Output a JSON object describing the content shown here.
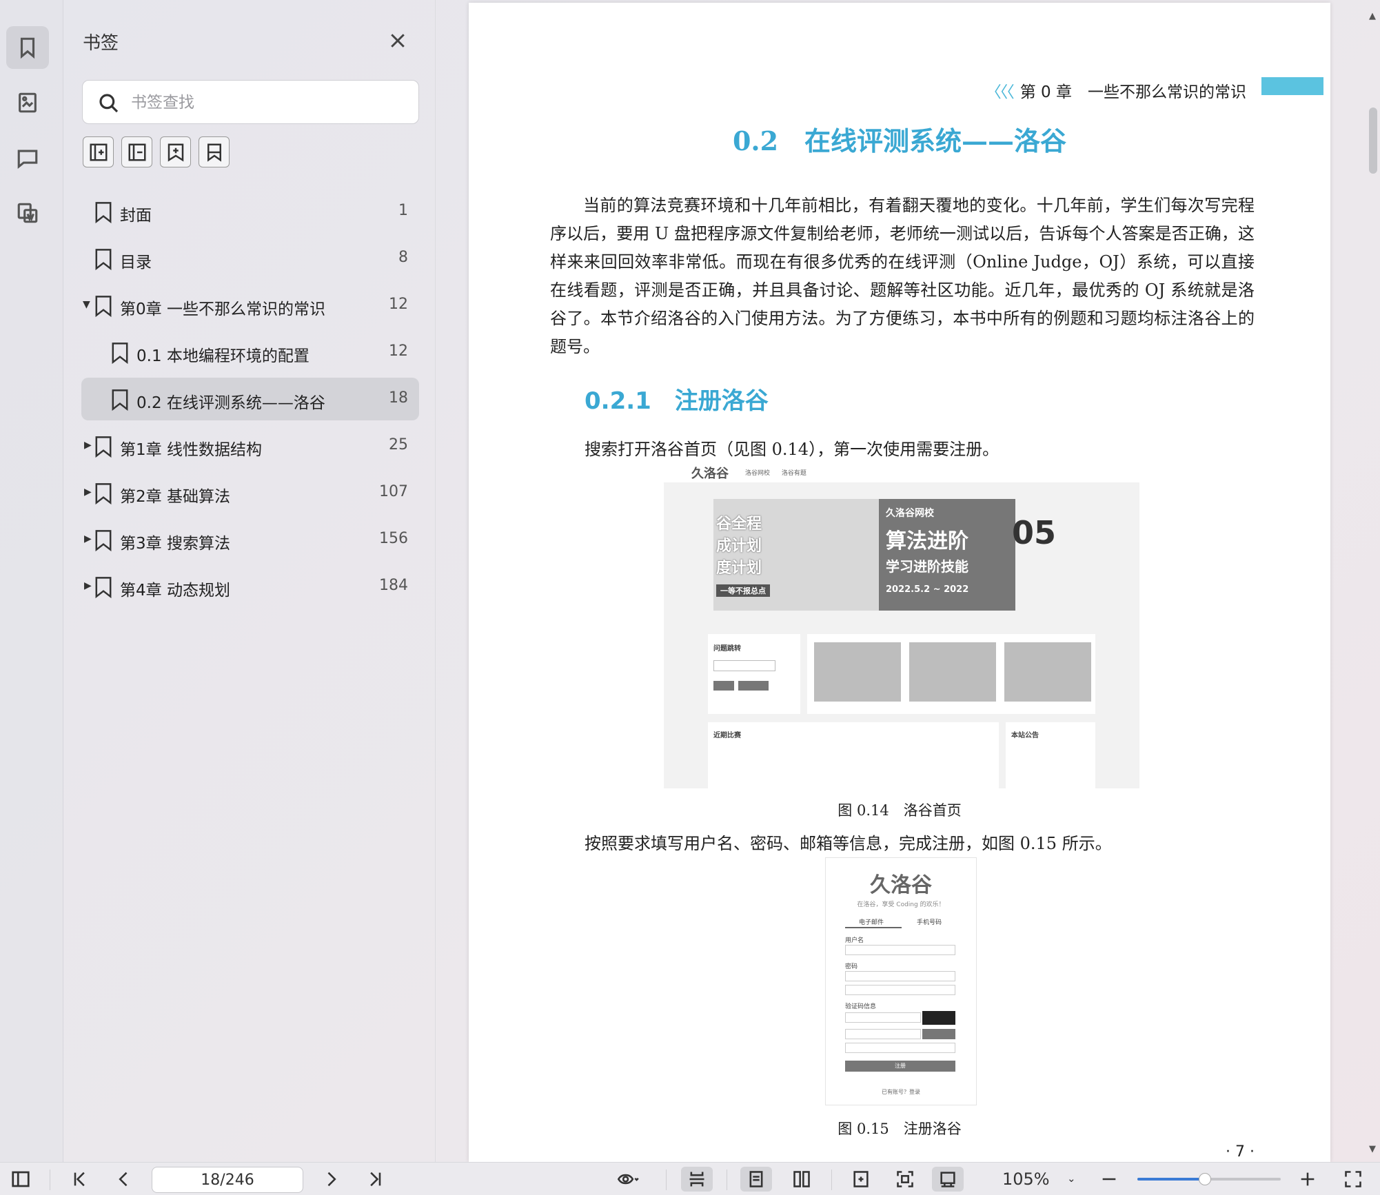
{
  "sidebar": {
    "title": "书签",
    "search_placeholder": "书签查找",
    "items": [
      {
        "label": "封面",
        "page": "1",
        "level": 0,
        "expander": "",
        "selected": false
      },
      {
        "label": "目录",
        "page": "8",
        "level": 0,
        "expander": "",
        "selected": false
      },
      {
        "label": "第0章 一些不那么常识的常识",
        "page": "12",
        "level": 0,
        "expander": "expanded",
        "selected": false
      },
      {
        "label": "0.1 本地编程环境的配置",
        "page": "12",
        "level": 1,
        "expander": "",
        "selected": false
      },
      {
        "label": "0.2 在线评测系统——洛谷",
        "page": "18",
        "level": 1,
        "expander": "",
        "selected": true
      },
      {
        "label": "第1章 线性数据结构",
        "page": "25",
        "level": 0,
        "expander": "collapsed",
        "selected": false
      },
      {
        "label": "第2章 基础算法",
        "page": "107",
        "level": 0,
        "expander": "collapsed",
        "selected": false
      },
      {
        "label": "第3章 搜索算法",
        "page": "156",
        "level": 0,
        "expander": "collapsed",
        "selected": false
      },
      {
        "label": "第4章 动态规划",
        "page": "184",
        "level": 0,
        "expander": "collapsed",
        "selected": false
      }
    ]
  },
  "document": {
    "running_header_chevrons": "〈〈〈",
    "running_header": "第 0 章　一些不那么常识的常识",
    "section_title": "0.2　在线评测系统——洛谷",
    "paragraph": "当前的算法竞赛环境和十几年前相比，有着翻天覆地的变化。十几年前，学生们每次写完程序以后，要用 U 盘把程序源文件复制给老师，老师统一测试以后，告诉每个人答案是否正确，这样来来回回效率非常低。而现在有很多优秀的在线评测（Online Judge，OJ）系统，可以直接在线看题，评测是否正确，并且具备讨论、题解等社区功能。近几年，最优秀的 OJ 系统就是洛谷了。本节介绍洛谷的入门使用方法。为了方便练习，本书中所有的例题和习题均标注洛谷上的题号。",
    "subsection_title": "0.2.1　注册洛谷",
    "line1": "搜索打开洛谷首页（见图 0.14），第一次使用需要注册。",
    "fig1_caption": "图 0.14　洛谷首页",
    "line2": "按照要求填写用户名、密码、邮箱等信息，完成注册，如图 0.15 所示。",
    "fig2_caption": "图 0.15　注册洛谷",
    "page_number": "· 7 ·",
    "fig1": {
      "logo": "久洛谷",
      "nav": "洛谷网校 洛谷有题",
      "banner_left": [
        "谷全程",
        "成计划",
        "度计划",
        "一等不报总点"
      ],
      "banner_right": [
        "久洛谷网校",
        "算法进阶",
        "学习进阶技能",
        "2022.5.2 ~ 2022"
      ],
      "date": "05",
      "problem_jump": "问题跳转",
      "recent_contests": "近期比赛",
      "announcements": "本站公告"
    },
    "fig2": {
      "logo": "久洛谷",
      "slogan": "在洛谷，享受 Coding 的欢乐！",
      "tab_email": "电子邮件",
      "tab_phone": "手机号码",
      "label_username": "用户名",
      "label_password": "密码",
      "label_captcha": "验证码信息",
      "button": "注册",
      "footer": "已有账号？登录"
    }
  },
  "toolbar": {
    "page_value": "18/246",
    "zoom": "105%",
    "zoom_fraction": 0.47
  },
  "colors": {
    "accent": "#3aa8d3",
    "header_bar": "#5bc3e0",
    "selection": "#d3d3d8",
    "slider": "#3a7bd5"
  }
}
